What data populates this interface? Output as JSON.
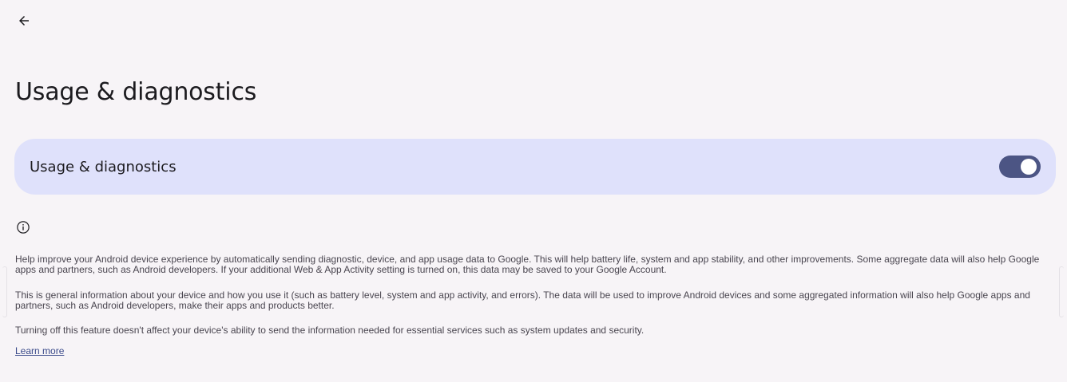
{
  "header": {
    "back_icon": "arrow-back-icon",
    "title": "Usage & diagnostics"
  },
  "toggle": {
    "label": "Usage & diagnostics",
    "state": "on",
    "accent_color": "#4c5584",
    "card_color": "#dfe1fb"
  },
  "info": {
    "icon": "info-icon",
    "paragraph_1": "Help improve your Android device experience by automatically sending diagnostic, device, and app usage data to Google. This will help battery life, system and app stability, and other improvements. Some aggregate data will also help Google apps and partners, such as Android developers. If your additional Web & App Activity setting is turned on, this data may be saved to your Google Account.",
    "paragraph_2": "This is general information about your device and how you use it (such as battery level, system and app activity, and errors). The data will be used to improve Android devices and some aggregated information will also help Google apps and partners, such as Android developers, make their apps and products better.",
    "paragraph_3": "Turning off this feature doesn't affect your device's ability to send the information needed for essential services such as system updates and security.",
    "learn_more": "Learn more"
  }
}
